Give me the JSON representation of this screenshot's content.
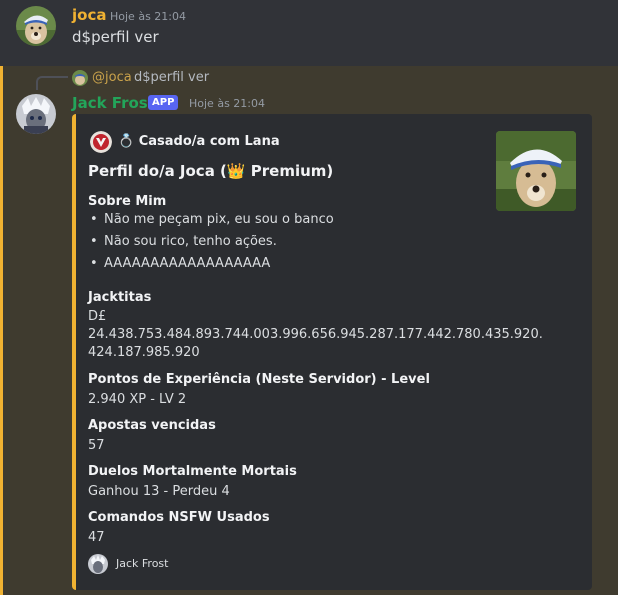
{
  "colors": {
    "background": "#313338",
    "mention_bg": "#3f3b2f",
    "accent": "#f0b232",
    "bot_name": "#23a55a",
    "user_name": "#f0b232"
  },
  "message1": {
    "author": "joca",
    "timestamp": "Hoje às 21:04",
    "text": "d$perfil ver",
    "avatar_icon": "dog-avatar-icon"
  },
  "message2": {
    "reply": {
      "mention": "@joca",
      "text": "d$perfil ver"
    },
    "author": "Jack Frost",
    "badge": "APP",
    "timestamp": "Hoje às 21:04",
    "embed": {
      "author_line": "💍 Casado/a com Lana",
      "title": "Perfil do/a Joca (👑 Premium)",
      "about_title": "Sobre Mim",
      "about_items": [
        "Não me peçam pix, eu sou o banco",
        "Não sou rico, tenho ações.",
        "AAAAAAAAAAAAAAAAAA"
      ],
      "fields": [
        {
          "name": "Jacktitas",
          "line1": "D£",
          "line2": "24.438.753.484.893.744.003.996.656.945.287.177.442.780.435.920.",
          "line3": "424.187.985.920"
        },
        {
          "name": "Pontos de Experiência (Neste Servidor) - Level",
          "value": "2.940 XP - LV 2"
        },
        {
          "name": "Apostas vencidas",
          "value": "57"
        },
        {
          "name": "Duelos Mortalmente Mortais",
          "value": "Ganhou 13 - Perdeu 4"
        },
        {
          "name": "Comandos NSFW Usados",
          "value": "47"
        }
      ],
      "footer": "Jack Frost"
    }
  }
}
